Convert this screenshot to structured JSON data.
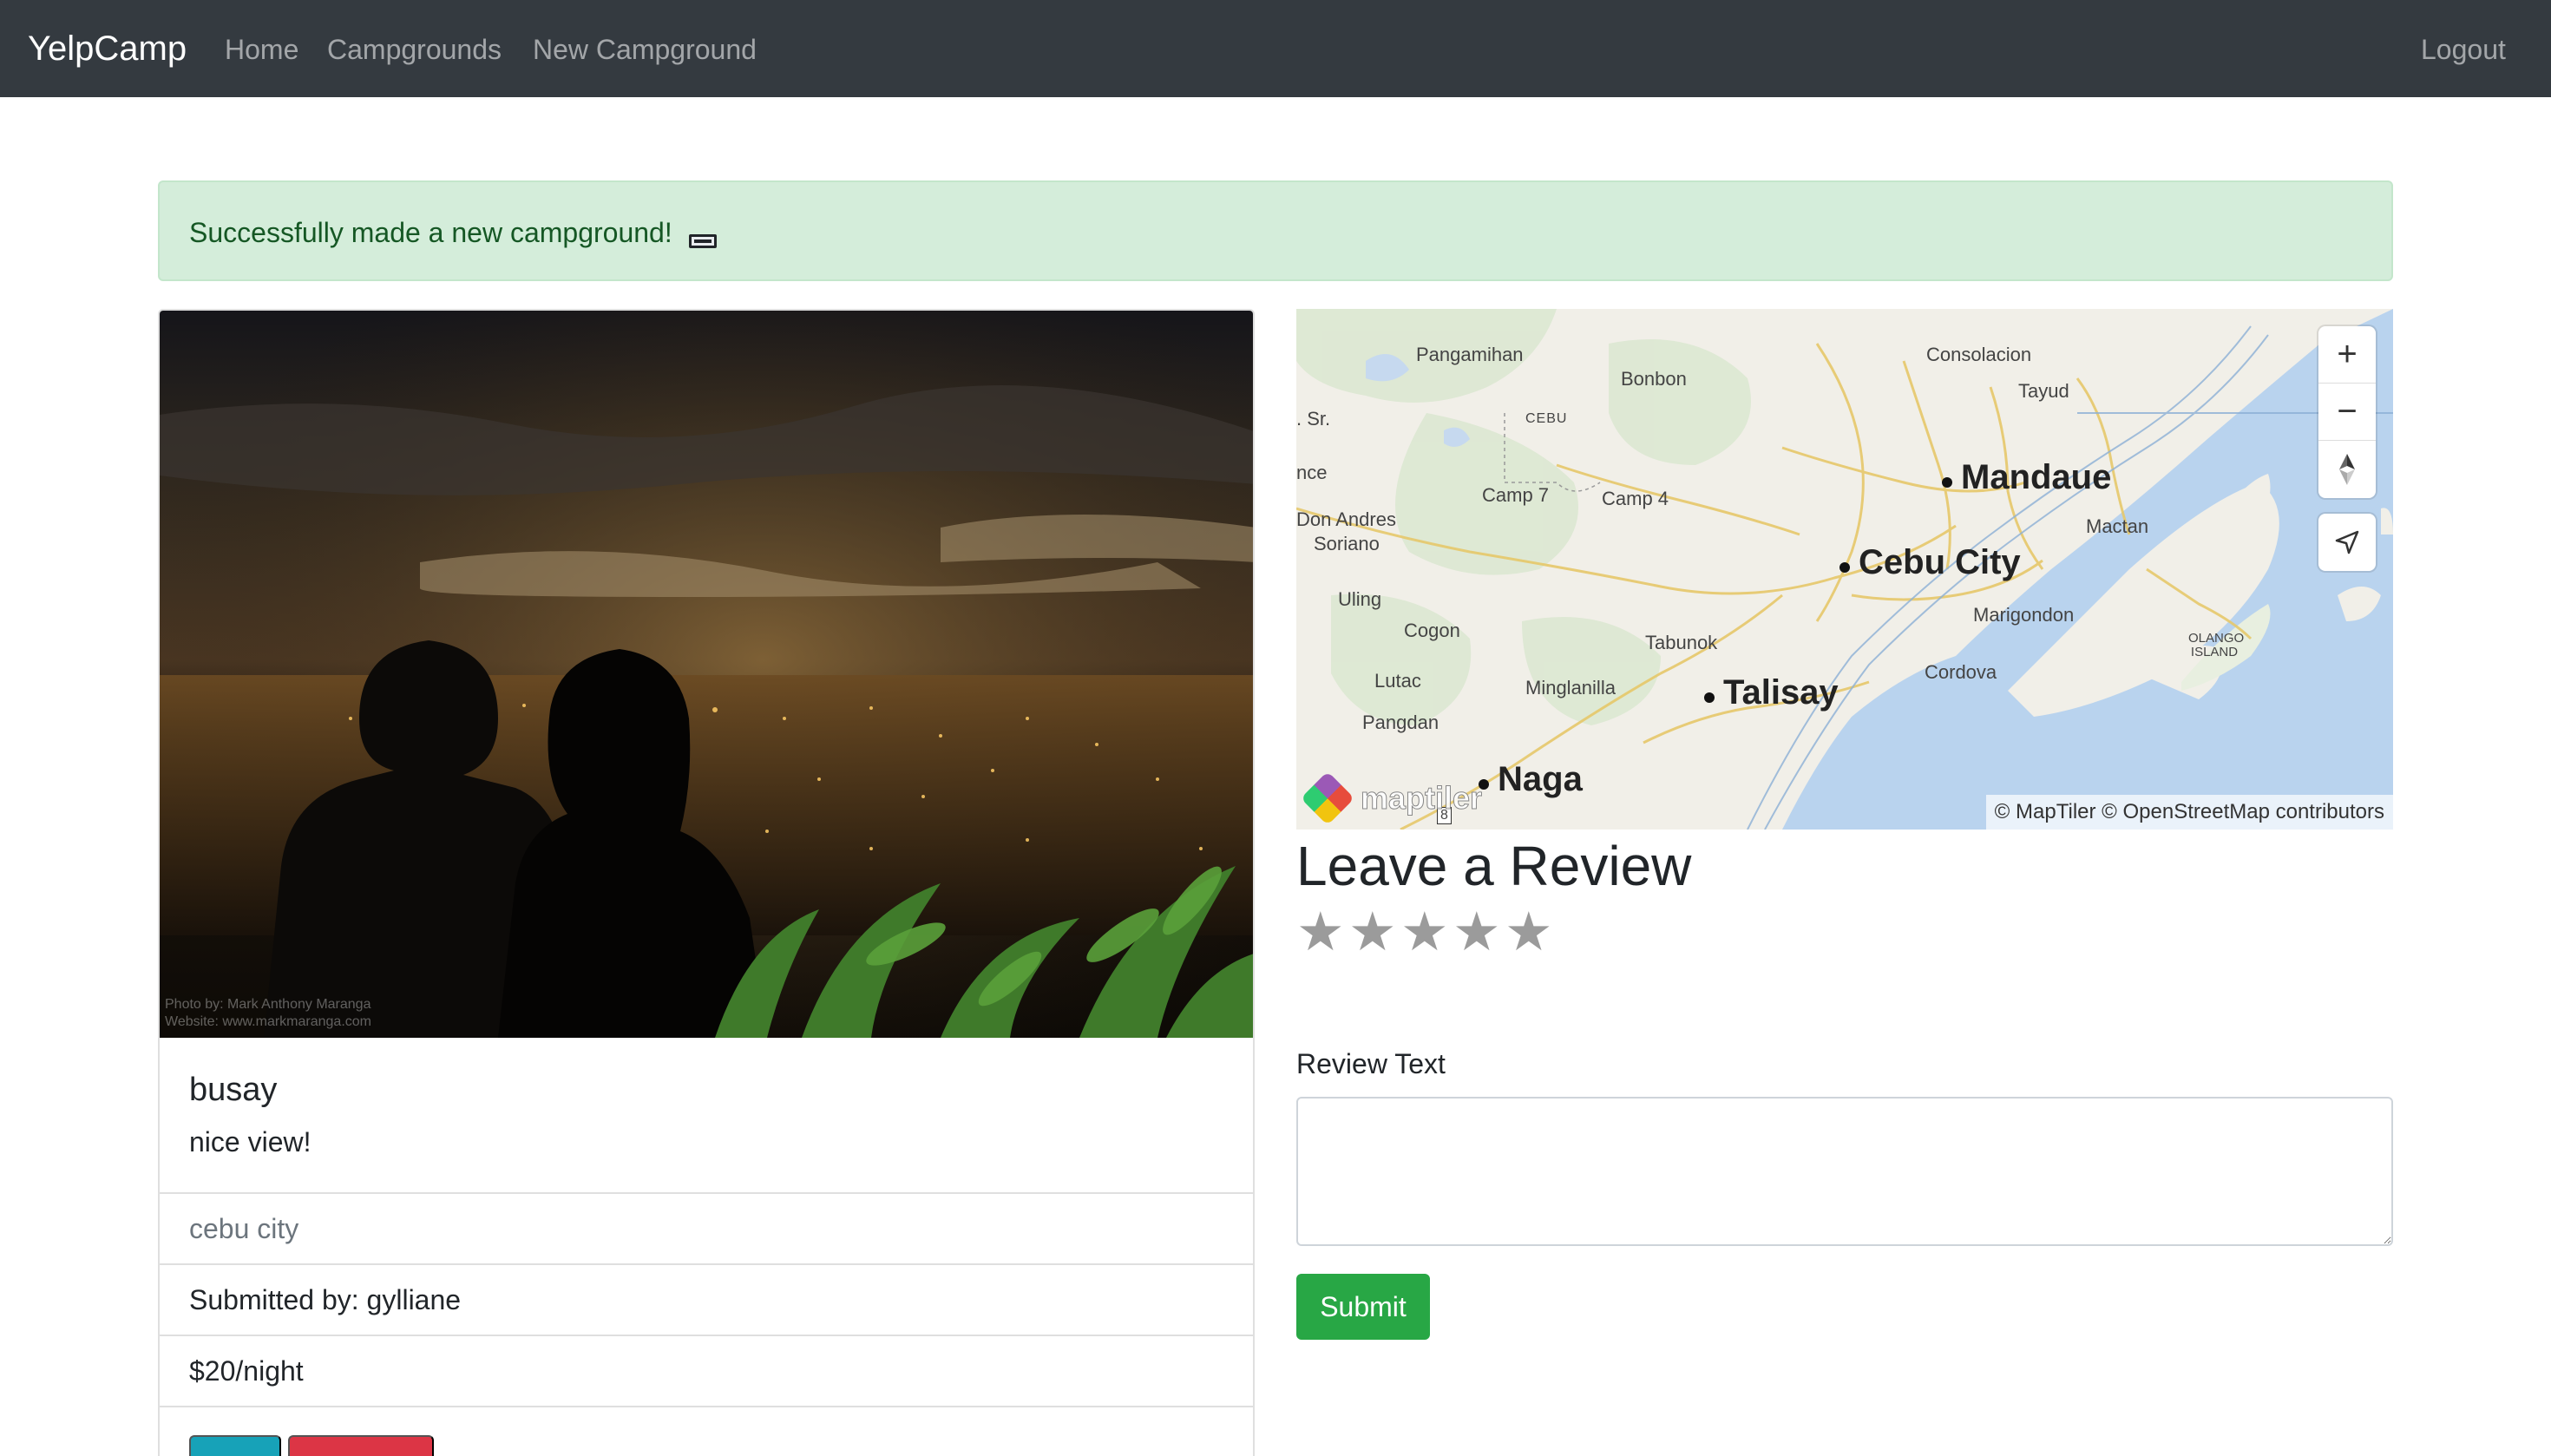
{
  "navbar": {
    "brand": "YelpCamp",
    "links": {
      "home": "Home",
      "campgrounds": "Campgrounds",
      "new_campground": "New Campground",
      "logout": "Logout"
    }
  },
  "alert": {
    "message": "Successfully made a new campground!",
    "color": "#d4edda"
  },
  "campground": {
    "title": "busay",
    "description": "nice view!",
    "location": "cebu city",
    "submitted_by": "Submitted by: gylliane",
    "price": "$20/night",
    "image_credit": {
      "line1": "Photo by: Mark Anthony Maranga",
      "line2": "Website: www.markmaranga.com"
    }
  },
  "map": {
    "labels": {
      "pangamihan": "Pangamihan",
      "bonbon": "Bonbon",
      "consolacion": "Consolacion",
      "tayud": "Tayud",
      "sr": ". Sr.",
      "cebu": "CEBU",
      "nce": "nce",
      "camp7": "Camp 7",
      "camp4": "Camp 4",
      "don_andres": "Don Andres",
      "soriano": "Soriano",
      "mactan": "Mactan",
      "uling": "Uling",
      "cogon": "Cogon",
      "marigondon": "Marigondon",
      "tabunok": "Tabunok",
      "olango": "OLANGO ISLAND",
      "cordova": "Cordova",
      "lutac": "Lutac",
      "minglanilla": "Minglanilla",
      "pangdan": "Pangdan",
      "route": "8"
    },
    "cities": {
      "mandaue": "Mandaue",
      "cebu_city": "Cebu City",
      "talisay": "Talisay",
      "naga": "Naga"
    },
    "controls": {
      "zoom_in": "+",
      "zoom_out": "−",
      "compass": "north-arrow-icon",
      "geolocate": "navigation-arrow-icon"
    },
    "logo": "maptiler",
    "attribution": "© MapTiler © OpenStreetMap contributors"
  },
  "review": {
    "heading": "Leave a Review",
    "star_count": 5,
    "rating": 0,
    "label": "Review Text",
    "text_value": "",
    "submit": "Submit"
  },
  "colors": {
    "navbar": "#343a40",
    "alert_bg": "#d4edda",
    "alert_text": "#155724",
    "edit_button": "#17a2b8",
    "delete_button": "#dc3545",
    "submit_button": "#28a745",
    "star": "#9b9b9b"
  }
}
